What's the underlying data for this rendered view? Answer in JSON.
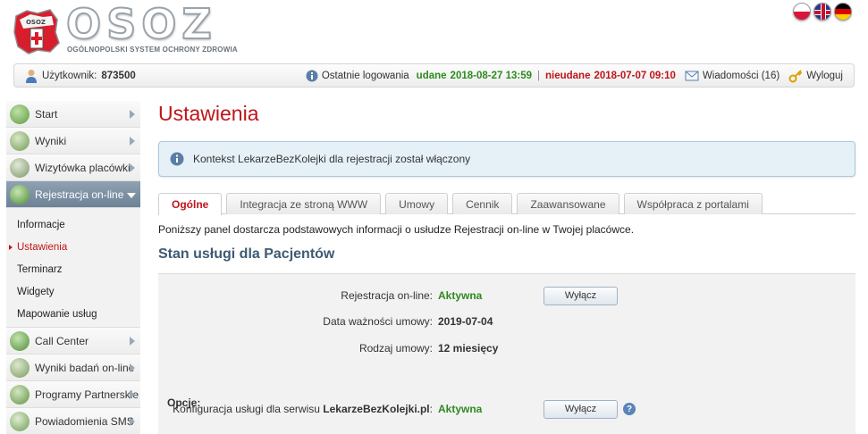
{
  "header": {
    "logo_text": "OSOZ",
    "logo_badge": "OSOZ",
    "logo_subtitle": "OGÓLNOPOLSKI SYSTEM OCHRONY ZDROWIA",
    "languages": [
      "pl",
      "en",
      "de"
    ]
  },
  "userbar": {
    "user_label": "Użytkownik:",
    "user_id": "873500",
    "last_logins_label": "Ostatnie logowania",
    "success_label": "udane",
    "success_value": "2018-08-27 13:59",
    "separator": "|",
    "fail_label": "nieudane",
    "fail_value": "2018-07-07 09:10",
    "messages": "Wiadomości (16)",
    "logout": "Wyloguj"
  },
  "sidebar": {
    "items": [
      {
        "label": "Start",
        "icon": "monitor-icon"
      },
      {
        "label": "Wyniki",
        "icon": "chart-icon"
      },
      {
        "label": "Wizytówka placówki",
        "icon": "compass-icon"
      },
      {
        "label": "Rejestracja on-line",
        "icon": "globe-icon",
        "active": true
      },
      {
        "label": "Call Center",
        "icon": "phone-icon"
      },
      {
        "label": "Wyniki badań on-line",
        "icon": "microscope-icon"
      },
      {
        "label": "Programy Partnerskie",
        "icon": "handshake-icon"
      },
      {
        "label": "Powiadomienia SMS",
        "icon": "sms-icon"
      }
    ],
    "submenu": [
      "Informacje",
      "Ustawienia",
      "Terminarz",
      "Widgety",
      "Mapowanie usług"
    ]
  },
  "main": {
    "title": "Ustawienia",
    "info": "Kontekst LekarzeBezKolejki dla rejestracji został włączony",
    "tabs": [
      "Ogólne",
      "Integracja ze stroną WWW",
      "Umowy",
      "Cennik",
      "Zaawansowane",
      "Współpraca z portalami"
    ],
    "description": "Poniższy panel dostarcza podstawowych informacji o usłudze Rejestracji on-line w Twojej placówce.",
    "section_title": "Stan usługi dla Pacjentów",
    "rows": [
      {
        "label": "Rejestracja on-line:",
        "value": "Aktywna",
        "button": "Wyłącz"
      },
      {
        "label": "Data ważności umowy:",
        "value": "2019-07-04"
      },
      {
        "label": "Rodzaj umowy:",
        "value": "12 miesięcy"
      }
    ],
    "options_label": "Opcje:",
    "option_row": {
      "label_prefix": "Konfiguracja usługi dla serwisu",
      "label_site": "LekarzeBezKolejki.pl",
      "label_suffix": ":",
      "value": "Aktywna",
      "button": "Wyłącz"
    }
  },
  "colors": {
    "accent_red": "#c0151a",
    "ok_green": "#2e8b1e",
    "section_blue": "#3d5a74"
  }
}
